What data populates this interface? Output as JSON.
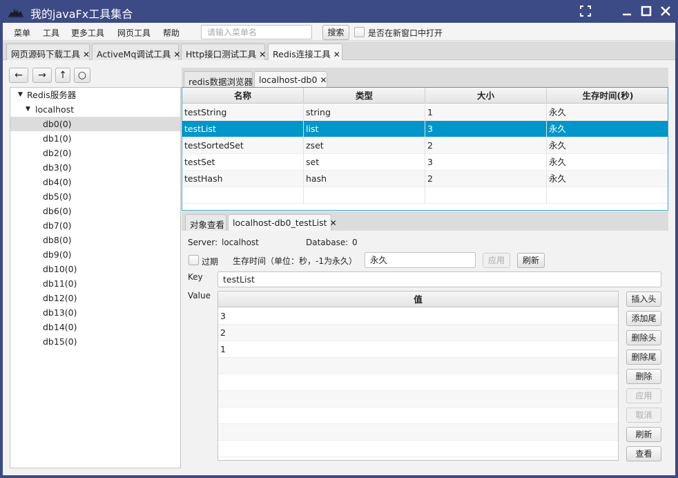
{
  "window": {
    "title": "我的javaFx工具集合"
  },
  "menubar": {
    "items": [
      "菜单",
      "工具",
      "更多工具",
      "网页工具",
      "帮助"
    ],
    "search_placeholder": "请输入菜单名",
    "search_button": "搜索",
    "new_window_label": "是否在新窗口中打开"
  },
  "main_tabs": [
    {
      "label": "网页源码下载工具",
      "active": false
    },
    {
      "label": "ActiveMq调试工具",
      "active": false
    },
    {
      "label": "Http接口测试工具",
      "active": false
    },
    {
      "label": "Redis连接工具",
      "active": true
    }
  ],
  "nav_buttons": [
    "←",
    "→",
    "↑",
    "○"
  ],
  "tree": {
    "root": "Redis服务器",
    "host": "localhost",
    "selected": "db0(0)",
    "dbs": [
      "db0(0)",
      "db1(0)",
      "db2(0)",
      "db3(0)",
      "db4(0)",
      "db5(0)",
      "db6(0)",
      "db7(0)",
      "db8(0)",
      "db9(0)",
      "db10(0)",
      "db11(0)",
      "db12(0)",
      "db13(0)",
      "db14(0)",
      "db15(0)"
    ]
  },
  "browser_tabs": [
    "redis数据浏览器",
    "localhost-db0"
  ],
  "key_table": {
    "columns": [
      "名称",
      "类型",
      "大小",
      "生存时间(秒)"
    ],
    "rows": [
      [
        "testString",
        "string",
        "1",
        "永久"
      ],
      [
        "testList",
        "list",
        "3",
        "永久"
      ],
      [
        "testSortedSet",
        "zset",
        "2",
        "永久"
      ],
      [
        "testSet",
        "set",
        "3",
        "永久"
      ],
      [
        "testHash",
        "hash",
        "2",
        "永久"
      ]
    ],
    "selected_row": 1
  },
  "detail_tabs": [
    "对象查看",
    "localhost-db0_testList"
  ],
  "detail": {
    "server_label": "Server:",
    "server_value": "localhost",
    "database_label": "Database:",
    "database_value": "0",
    "expire_label": "过期",
    "ttl_label": "生存时间（单位：秒，-1为永久）",
    "ttl_value": "永久",
    "apply_label": "应用",
    "refresh_label": "刷新",
    "key_label": "Key",
    "key_value": "testList",
    "value_label": "Value",
    "value_column": "值",
    "values": [
      "3",
      "2",
      "1"
    ],
    "actions": [
      {
        "label": "插入头",
        "enabled": true
      },
      {
        "label": "添加尾",
        "enabled": true
      },
      {
        "label": "删除头",
        "enabled": true
      },
      {
        "label": "删除尾",
        "enabled": true
      },
      {
        "label": "删除",
        "enabled": true
      },
      {
        "label": "应用",
        "enabled": false
      },
      {
        "label": "取消",
        "enabled": false
      },
      {
        "label": "刷新",
        "enabled": true
      },
      {
        "label": "查看",
        "enabled": true
      }
    ]
  },
  "colors": {
    "titlebar": "#3c4a85",
    "selection": "#0096c9",
    "focus_border": "#3aa1cc"
  }
}
